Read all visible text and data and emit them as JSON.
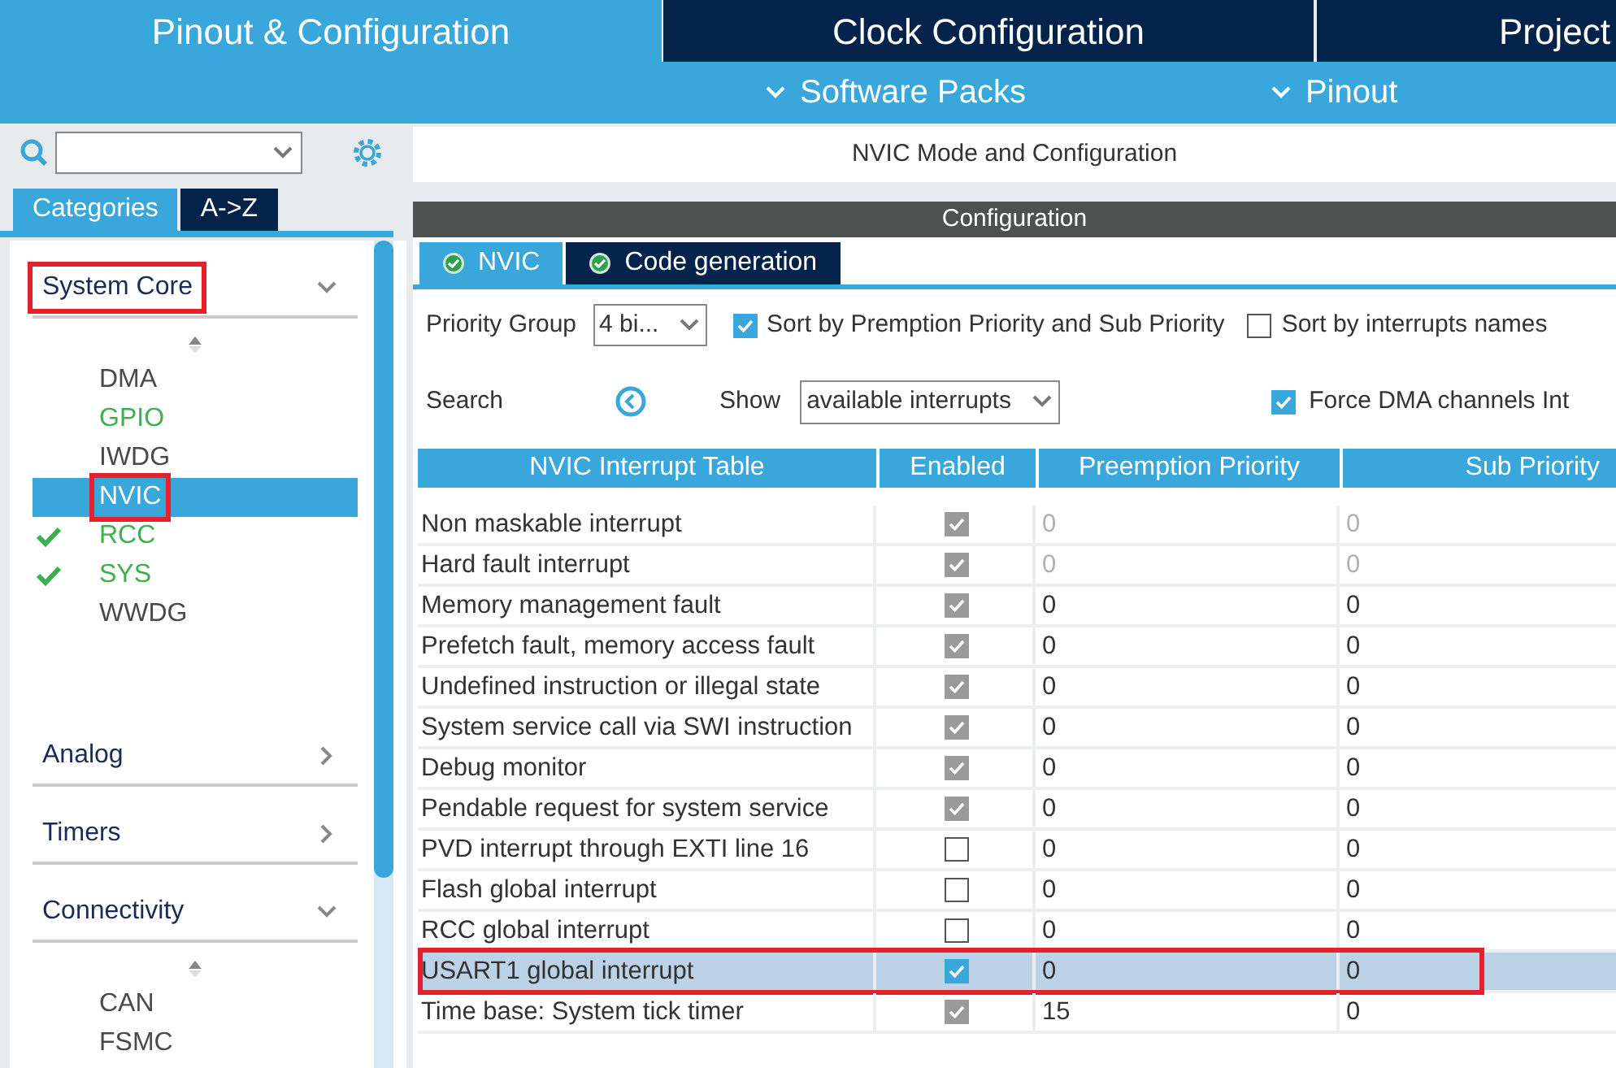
{
  "top_tabs": [
    {
      "label": "Pinout & Configuration",
      "selected": true
    },
    {
      "label": "Clock Configuration",
      "selected": false
    },
    {
      "label": "Project",
      "selected": false
    }
  ],
  "sub_menu": [
    {
      "label": "Software Packs"
    },
    {
      "label": "Pinout"
    }
  ],
  "sidebar": {
    "view_tabs": [
      {
        "label": "Categories",
        "selected": true
      },
      {
        "label": "A->Z",
        "selected": false
      }
    ],
    "categories": [
      {
        "label": "System Core",
        "expanded": true,
        "annotated": true,
        "items": [
          {
            "label": "DMA",
            "configured": false,
            "checked": false,
            "selected": false,
            "annotated": false
          },
          {
            "label": "GPIO",
            "configured": true,
            "checked": false,
            "selected": false,
            "annotated": false
          },
          {
            "label": "IWDG",
            "configured": false,
            "checked": false,
            "selected": false,
            "annotated": false
          },
          {
            "label": "NVIC",
            "checked": false,
            "selected": true,
            "annotated": true
          },
          {
            "label": "RCC",
            "configured": true,
            "checked": true,
            "selected": false,
            "annotated": false
          },
          {
            "label": "SYS",
            "configured": true,
            "checked": true,
            "selected": false,
            "annotated": false
          },
          {
            "label": "WWDG",
            "configured": false,
            "checked": false,
            "selected": false,
            "annotated": false
          }
        ]
      },
      {
        "label": "Analog",
        "expanded": false,
        "annotated": false
      },
      {
        "label": "Timers",
        "expanded": false,
        "annotated": false
      },
      {
        "label": "Connectivity",
        "expanded": true,
        "annotated": false,
        "items": [
          {
            "label": "CAN",
            "configured": false,
            "checked": false,
            "selected": false,
            "annotated": false
          },
          {
            "label": "FSMC",
            "configured": false,
            "checked": false,
            "selected": false,
            "annotated": false
          }
        ]
      }
    ]
  },
  "panel": {
    "title": "NVIC Mode and Configuration",
    "config_title": "Configuration",
    "tabs": [
      {
        "label": "NVIC",
        "selected": true
      },
      {
        "label": "Code generation",
        "selected": false
      }
    ],
    "priority_group": {
      "label": "Priority Group",
      "value": "4 bi..."
    },
    "sort_options": [
      {
        "label": "Sort by Premption Priority and Sub Priority",
        "checked": true
      },
      {
        "label": "Sort by interrupts names",
        "checked": false
      }
    ],
    "search_label": "Search",
    "show": {
      "label": "Show",
      "value": "available interrupts"
    },
    "force_dma": {
      "label": "Force DMA channels Int",
      "checked": true
    },
    "table": {
      "columns": [
        "NVIC Interrupt Table",
        "Enabled",
        "Preemption Priority",
        "Sub Priority"
      ],
      "rows": [
        {
          "name": "Non maskable interrupt",
          "enabled": true,
          "enabled_locked": true,
          "preemption": "0",
          "sub": "0",
          "priority_locked": true,
          "selected": false,
          "annotated": false
        },
        {
          "name": "Hard fault interrupt",
          "enabled": true,
          "enabled_locked": true,
          "preemption": "0",
          "sub": "0",
          "priority_locked": true,
          "selected": false,
          "annotated": false
        },
        {
          "name": "Memory management fault",
          "enabled": true,
          "enabled_locked": true,
          "preemption": "0",
          "sub": "0",
          "priority_locked": false,
          "selected": false,
          "annotated": false
        },
        {
          "name": "Prefetch fault, memory access fault",
          "enabled": true,
          "enabled_locked": true,
          "preemption": "0",
          "sub": "0",
          "priority_locked": false,
          "selected": false,
          "annotated": false
        },
        {
          "name": "Undefined instruction or illegal state",
          "enabled": true,
          "enabled_locked": true,
          "preemption": "0",
          "sub": "0",
          "priority_locked": false,
          "selected": false,
          "annotated": false
        },
        {
          "name": "System service call via SWI instruction",
          "enabled": true,
          "enabled_locked": true,
          "preemption": "0",
          "sub": "0",
          "priority_locked": false,
          "selected": false,
          "annotated": false
        },
        {
          "name": "Debug monitor",
          "enabled": true,
          "enabled_locked": true,
          "preemption": "0",
          "sub": "0",
          "priority_locked": false,
          "selected": false,
          "annotated": false
        },
        {
          "name": "Pendable request for system service",
          "enabled": true,
          "enabled_locked": true,
          "preemption": "0",
          "sub": "0",
          "priority_locked": false,
          "selected": false,
          "annotated": false
        },
        {
          "name": "PVD interrupt through EXTI line 16",
          "enabled": false,
          "preemption": "0",
          "sub": "0",
          "priority_locked": false,
          "selected": false,
          "annotated": false
        },
        {
          "name": "Flash global interrupt",
          "enabled": false,
          "preemption": "0",
          "sub": "0",
          "priority_locked": false,
          "selected": false,
          "annotated": false
        },
        {
          "name": "RCC global interrupt",
          "enabled": false,
          "preemption": "0",
          "sub": "0",
          "priority_locked": false,
          "selected": false,
          "annotated": false
        },
        {
          "name": "USART1 global interrupt",
          "enabled": true,
          "enabled_locked": false,
          "preemption": "0",
          "sub": "0",
          "priority_locked": false,
          "selected": true,
          "annotated": true
        },
        {
          "name": "Time base: System tick timer",
          "enabled": true,
          "enabled_locked": true,
          "preemption": "15",
          "sub": "0",
          "priority_locked": false,
          "selected": false,
          "annotated": false
        }
      ]
    }
  }
}
